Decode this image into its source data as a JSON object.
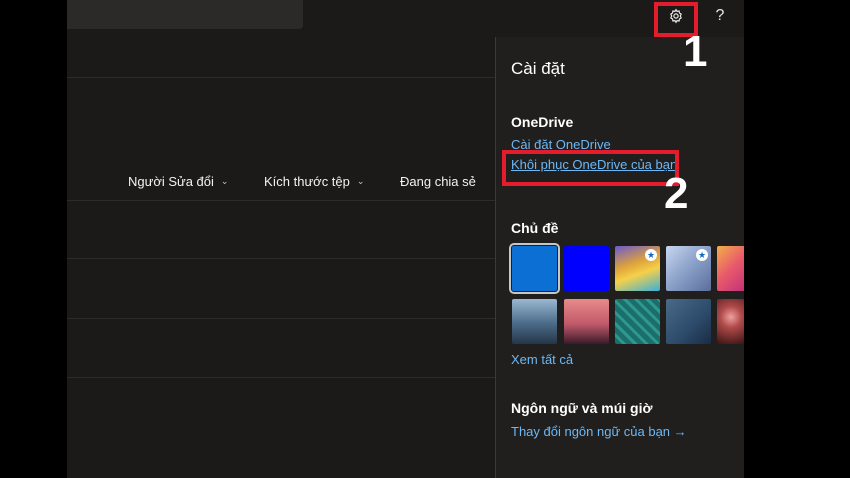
{
  "topbar": {
    "settings_icon": "gear-icon",
    "help_label": "?"
  },
  "columns": [
    {
      "label": "Người Sửa đổi",
      "has_chevron": true
    },
    {
      "label": "Kích thước tệp",
      "has_chevron": true
    },
    {
      "label": "Đang chia sẻ",
      "has_chevron": false
    }
  ],
  "chevron_glyph": "⌄",
  "settings_panel": {
    "title": "Cài đặt",
    "onedrive": {
      "heading": "OneDrive",
      "settings_link": "Cài đặt OneDrive",
      "restore_link": "Khôi phục OneDrive của bạn"
    },
    "themes": {
      "heading": "Chủ đề",
      "items": [
        {
          "name": "blue",
          "color": "#0b6fd3",
          "selected": true,
          "premium": false
        },
        {
          "name": "bright-blue",
          "color": "#0000ff",
          "selected": false,
          "premium": false
        },
        {
          "name": "rainbow-waves",
          "color": "#e0a43a",
          "selected": false,
          "premium": true
        },
        {
          "name": "feathers",
          "color": "#8aa0c8",
          "selected": false,
          "premium": true
        },
        {
          "name": "floral",
          "color": "#e85a6a",
          "selected": false,
          "premium": false
        },
        {
          "name": "mountains",
          "color": "#4a6a88",
          "selected": false,
          "premium": false
        },
        {
          "name": "palm-sunset",
          "color": "#c25a6a",
          "selected": false,
          "premium": false
        },
        {
          "name": "circuit",
          "color": "#1d6e6a",
          "selected": false,
          "premium": false
        },
        {
          "name": "aviation",
          "color": "#2c4a6a",
          "selected": false,
          "premium": false
        },
        {
          "name": "lights",
          "color": "#7a2a2a",
          "selected": false,
          "premium": false
        }
      ],
      "see_all": "Xem tất cả"
    },
    "language": {
      "heading": "Ngôn ngữ và múi giờ",
      "change_link": "Thay đổi ngôn ngữ của bạn",
      "arrow": "→"
    }
  },
  "annotations": {
    "step1": "1",
    "step2": "2",
    "color": "#e41c2c"
  }
}
